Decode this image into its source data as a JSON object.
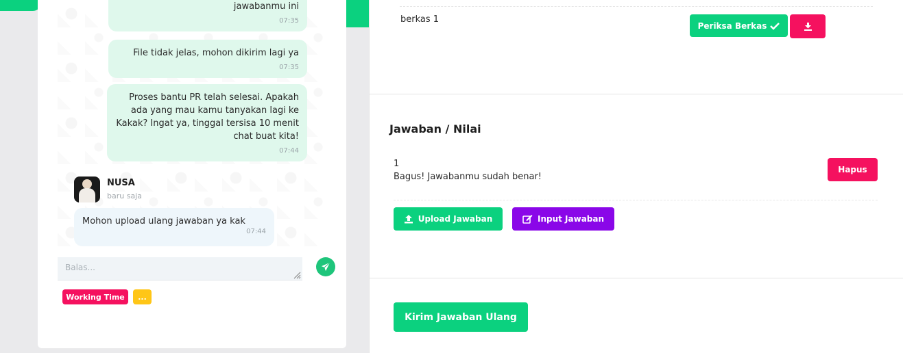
{
  "chat": {
    "messages_out": [
      {
        "text": "jawabanmu ini",
        "time": "07:35"
      },
      {
        "text": "File tidak jelas, mohon dikirim lagi ya",
        "time": "07:35"
      },
      {
        "text": "Proses bantu PR telah selesai. Apakah ada yang mau kamu tanyakan lagi ke Kakak? Ingat ya, tinggal tersisa 10 menit chat buat kita!",
        "time": "07:44"
      }
    ],
    "sender": {
      "name": "NUSA",
      "time_label": "baru saja"
    },
    "message_in": {
      "text": "Mohon upload ulang jawaban ya kak",
      "time": "07:44"
    },
    "reply_placeholder": "Balas...",
    "send_icon": "paper-plane-icon",
    "tags": {
      "working_time": "Working Time",
      "dots": "..."
    }
  },
  "files": {
    "file_name": "berkas 1",
    "check_button": "Periksa Berkas",
    "check_icon": "check-icon",
    "download_icon": "download-icon"
  },
  "answers": {
    "title": "Jawaban / Nilai",
    "number": "1",
    "feedback": "Bagus! Jawabanmu sudah benar!",
    "delete_button": "Hapus",
    "upload_button": "Upload Jawaban",
    "upload_icon": "upload-icon",
    "input_button": "Input Jawaban",
    "input_icon": "edit-icon"
  },
  "submit_button": "Kirim Jawaban Ulang",
  "colors": {
    "green": "#0bd17f",
    "pink": "#f5115f",
    "purple": "#8a07e8",
    "yellow": "#ffc617",
    "bubble_out": "#dff8ec",
    "bubble_in": "#eef6fb"
  }
}
